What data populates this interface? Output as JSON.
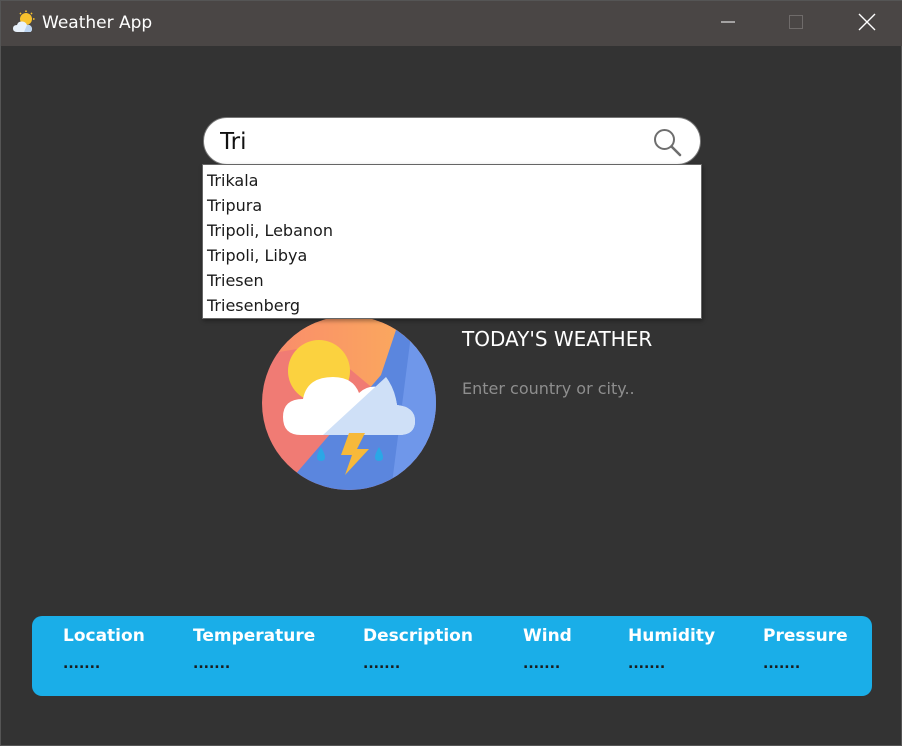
{
  "window": {
    "title": "Weather App",
    "icon": "weather-app-icon",
    "controls": {
      "minimize": "minimize-icon",
      "maximize": "maximize-icon",
      "close": "close-icon"
    }
  },
  "search": {
    "value": "Tri",
    "icon": "search-icon",
    "suggestions": [
      "Trikala",
      "Tripura",
      "Tripoli, Lebanon",
      "Tripoli, Libya",
      "Triesen",
      "Triesenberg"
    ]
  },
  "weather": {
    "icon": "sun-cloud-rain-thunder-icon",
    "heading": "TODAY'S WEATHER",
    "prompt": "Enter country or city.."
  },
  "details": {
    "columns": [
      {
        "label": "Location",
        "value": "......."
      },
      {
        "label": "Temperature",
        "value": "......."
      },
      {
        "label": "Description",
        "value": "......."
      },
      {
        "label": "Wind",
        "value": "......."
      },
      {
        "label": "Humidity",
        "value": "......."
      },
      {
        "label": "Pressure",
        "value": "......."
      }
    ]
  },
  "colors": {
    "titlebar": "#4a4645",
    "background": "#333333",
    "info_bar": "#1aaee8"
  }
}
